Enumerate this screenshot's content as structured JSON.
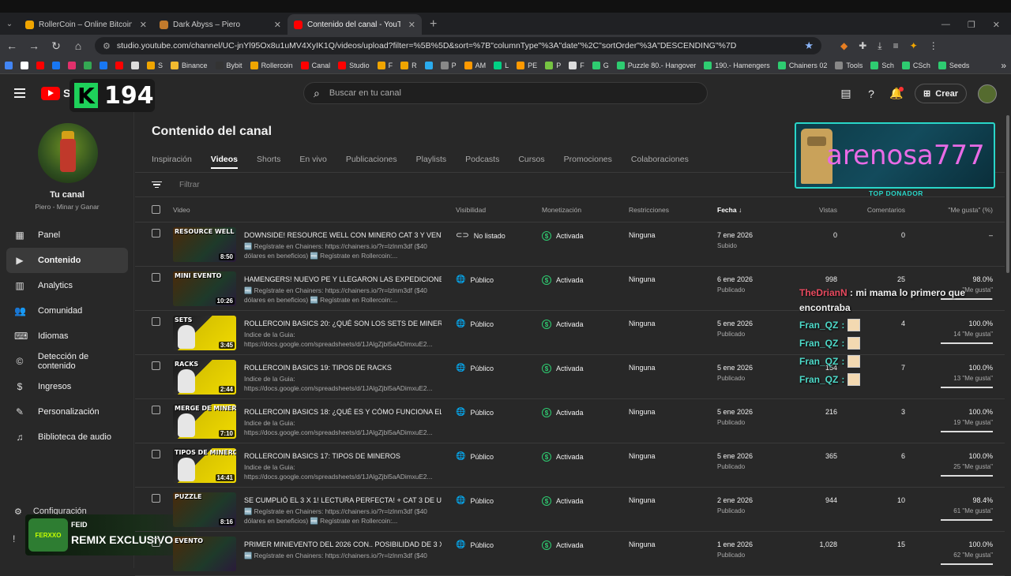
{
  "browser": {
    "tabs": [
      {
        "title": "RollerCoin – Online Bitcoin Min",
        "color": "#f0a500"
      },
      {
        "title": "Dark Abyss – Piero",
        "color": "#c27a2c"
      },
      {
        "title": "Contenido del canal - YouTube",
        "color": "#ff0000"
      }
    ],
    "url": "studio.youtube.com/channel/UC-jnYl95Ox8u1uMV4XyIK1Q/videos/upload?filter=%5B%5D&sort=%7B\"columnType\"%3A\"date\"%2C\"sortOrder\"%3A\"DESCENDING\"%7D",
    "bookmarks": [
      {
        "label": "",
        "color": "#4285f4"
      },
      {
        "label": "",
        "color": "#fff"
      },
      {
        "label": "",
        "color": "#ff0000"
      },
      {
        "label": "",
        "color": "#1877f2"
      },
      {
        "label": "",
        "color": "#e1306c"
      },
      {
        "label": "",
        "color": "#34a853"
      },
      {
        "label": "",
        "color": "#1877f2"
      },
      {
        "label": "",
        "color": "#ff0000"
      },
      {
        "label": "",
        "color": "#ddd"
      },
      {
        "label": "S",
        "color": "#f0a500"
      },
      {
        "label": "Binance",
        "color": "#f3ba2f"
      },
      {
        "label": "Bybit",
        "color": "#333"
      },
      {
        "label": "Rollercoin",
        "color": "#f0a500"
      },
      {
        "label": "Canal",
        "color": "#ff0000"
      },
      {
        "label": "Studio",
        "color": "#ff0000"
      },
      {
        "label": "F",
        "color": "#f0a500"
      },
      {
        "label": "R",
        "color": "#f0a500"
      },
      {
        "label": "",
        "color": "#2aabee"
      },
      {
        "label": "P",
        "color": "#888"
      },
      {
        "label": "AM",
        "color": "#f90"
      },
      {
        "label": "L",
        "color": "#00d084"
      },
      {
        "label": "PE",
        "color": "#f90"
      },
      {
        "label": "P",
        "color": "#76c442"
      },
      {
        "label": "F",
        "color": "#ddd"
      },
      {
        "label": "G",
        "color": "#2ecc71"
      },
      {
        "label": "Puzzle 80.- Hangover",
        "color": "#2ecc71"
      },
      {
        "label": "190.- Hamengers",
        "color": "#2ecc71"
      },
      {
        "label": "Chainers 02",
        "color": "#2ecc71"
      },
      {
        "label": "Tools",
        "color": "#888"
      },
      {
        "label": "Sch",
        "color": "#2ecc71"
      },
      {
        "label": "CSch",
        "color": "#2ecc71"
      },
      {
        "label": "Seeds",
        "color": "#2ecc71"
      }
    ]
  },
  "header": {
    "logo_text": "Stu",
    "k_letter": "K",
    "k_count": "194",
    "search_placeholder": "Buscar en tu canal",
    "create_label": "Crear"
  },
  "sidebar": {
    "channel_title": "Tu canal",
    "channel_sub": "Piero - Minar y Ganar",
    "items": [
      {
        "label": "Panel",
        "icon": "▦"
      },
      {
        "label": "Contenido",
        "icon": "▶"
      },
      {
        "label": "Analytics",
        "icon": "▥"
      },
      {
        "label": "Comunidad",
        "icon": "👥"
      },
      {
        "label": "Idiomas",
        "icon": "⌨"
      },
      {
        "label": "Detección de contenido",
        "icon": "©"
      },
      {
        "label": "Ingresos",
        "icon": "$"
      },
      {
        "label": "Personalización",
        "icon": "✎"
      },
      {
        "label": "Biblioteca de audio",
        "icon": "♫"
      }
    ],
    "config_label": "Configuración"
  },
  "overlay": {
    "feid_artist": "FEID",
    "feid_title": "REMIX EXCLUSIVO",
    "feid_logo": "FERXXO",
    "donor_name": "arenosa777",
    "donor_label": "TOP DONADOR",
    "chat": {
      "user": "TheDrianN",
      "message": ": mi mama lo primero que encontraba",
      "repeats": [
        "Fran_QZ",
        "Fran_QZ",
        "Fran_QZ",
        "Fran_QZ"
      ],
      "sep": ":"
    }
  },
  "main": {
    "title": "Contenido del canal",
    "tabs": [
      "Inspiración",
      "Videos",
      "Shorts",
      "En vivo",
      "Publicaciones",
      "Playlists",
      "Podcasts",
      "Cursos",
      "Promociones",
      "Colaboraciones"
    ],
    "filter_placeholder": "Filtrar",
    "columns": {
      "video": "Video",
      "visibility": "Visibilidad",
      "monetization": "Monetización",
      "restrictions": "Restricciones",
      "date": "Fecha",
      "views": "Vistas",
      "comments": "Comentarios",
      "likes": "\"Me gusta\" (%)"
    },
    "rows": [
      {
        "thumb_title": "RESOURCE WELL",
        "duration": "8:50",
        "title": "DOWNSIDE! RESOURCE WELL CON MINERO CAT 3 Y VENTA ...",
        "desc": "🆓 Regístrate en Chainers: https://chainers.io/?r=lzlnm3df ($40 dólares en beneficios) 🆓 Regístrate en Rollercoin:...",
        "vis_icon": "⊂⊃",
        "visibility": "No listado",
        "monetization": "Activada",
        "restrictions": "Ninguna",
        "date": "7 ene 2026",
        "status": "Subido",
        "views": "0",
        "comments": "0",
        "likes": "–",
        "likes_sub": "",
        "likes_ratio": 0,
        "style": "dark"
      },
      {
        "thumb_title": "MINI EVENTO",
        "duration": "10:26",
        "title": "HAMENGERS! NUEVO PE Y LLEGARON LAS EXPEDICIONES ...",
        "desc": "🆓 Regístrate en Chainers: https://chainers.io/?r=lzlnm3df ($40 dólares en beneficios) 🆓 Regístrate en Rollercoin:...",
        "vis_icon": "🌐",
        "visibility": "Público",
        "monetization": "Activada",
        "restrictions": "Ninguna",
        "date": "6 ene 2026",
        "status": "Publicado",
        "views": "998",
        "comments": "25",
        "likes": "98.0%",
        "likes_sub": "\"Me gusta\"",
        "likes_ratio": 0.98,
        "style": "dark"
      },
      {
        "thumb_title": "SETS",
        "duration": "3:45",
        "title": "ROLLERCOIN BASICS 20: ¿QUÉ SON LOS SETS DE MINEROS ...",
        "desc": "Indice de la Guia: https://docs.google.com/spreadsheets/d/1JAlgZjbl5aADimxuE2...",
        "vis_icon": "🌐",
        "visibility": "Público",
        "monetization": "Activada",
        "restrictions": "Ninguna",
        "date": "5 ene 2026",
        "status": "Publicado",
        "views": "",
        "comments": "4",
        "likes": "100.0%",
        "likes_sub": "14 \"Me gusta\"",
        "likes_ratio": 1.0,
        "style": "yellow"
      },
      {
        "thumb_title": "RACKS",
        "duration": "2:44",
        "title": "ROLLERCOIN BASICS 19: TIPOS DE RACKS",
        "desc": "Indice de la Guia: https://docs.google.com/spreadsheets/d/1JAlgZjbl5aADimxuE2...",
        "vis_icon": "🌐",
        "visibility": "Público",
        "monetization": "Activada",
        "restrictions": "Ninguna",
        "date": "5 ene 2026",
        "status": "Publicado",
        "views": "154",
        "comments": "7",
        "likes": "100.0%",
        "likes_sub": "13 \"Me gusta\"",
        "likes_ratio": 1.0,
        "style": "yellow"
      },
      {
        "thumb_title": "MERGE DE MINEROS",
        "duration": "7:10",
        "title": "ROLLERCOIN BASICS 18: ¿QUÉ ES Y CÓMO FUNCIONA EL M...",
        "desc": "Indice de la Guia: https://docs.google.com/spreadsheets/d/1JAlgZjbl5aADimxuE2...",
        "vis_icon": "🌐",
        "visibility": "Público",
        "monetization": "Activada",
        "restrictions": "Ninguna",
        "date": "5 ene 2026",
        "status": "Publicado",
        "views": "216",
        "comments": "3",
        "likes": "100.0%",
        "likes_sub": "19 \"Me gusta\"",
        "likes_ratio": 1.0,
        "style": "yellow"
      },
      {
        "thumb_title": "TIPOS DE MINEROS",
        "duration": "14:41",
        "title": "ROLLERCOIN BASICS 17: TIPOS DE MINEROS",
        "desc": "Indice de la Guia: https://docs.google.com/spreadsheets/d/1JAlgZjbl5aADimxuE2...",
        "vis_icon": "🌐",
        "visibility": "Público",
        "monetization": "Activada",
        "restrictions": "Ninguna",
        "date": "5 ene 2026",
        "status": "Publicado",
        "views": "365",
        "comments": "6",
        "likes": "100.0%",
        "likes_sub": "25 \"Me gusta\"",
        "likes_ratio": 1.0,
        "style": "yellow"
      },
      {
        "thumb_title": "PUZZLE",
        "duration": "8:16",
        "title": "SE CUMPLIÓ EL 3 X 1! LECTURA PERFECTA! + CAT 3 DE UNA...",
        "desc": "🆓 Regístrate en Chainers: https://chainers.io/?r=lzlnm3df ($40 dólares en beneficios) 🆓 Regístrate en Rollercoin:...",
        "vis_icon": "🌐",
        "visibility": "Público",
        "monetization": "Activada",
        "restrictions": "Ninguna",
        "date": "2 ene 2026",
        "status": "Publicado",
        "views": "944",
        "comments": "10",
        "likes": "98.4%",
        "likes_sub": "61 \"Me gusta\"",
        "likes_ratio": 0.984,
        "style": "dark"
      },
      {
        "thumb_title": "EVENTO",
        "duration": "",
        "title": "PRIMER MINIEVENTO DEL 2026 CON.. POSIBILIDAD DE 3 X 1...",
        "desc": "🆓 Regístrate en Chainers: https://chainers.io/?r=lzlnm3df ($40",
        "vis_icon": "🌐",
        "visibility": "Público",
        "monetization": "Activada",
        "restrictions": "Ninguna",
        "date": "1 ene 2026",
        "status": "Publicado",
        "views": "1,028",
        "comments": "15",
        "likes": "100.0%",
        "likes_sub": "62 \"Me gusta\"",
        "likes_ratio": 1.0,
        "style": "dark"
      }
    ]
  }
}
